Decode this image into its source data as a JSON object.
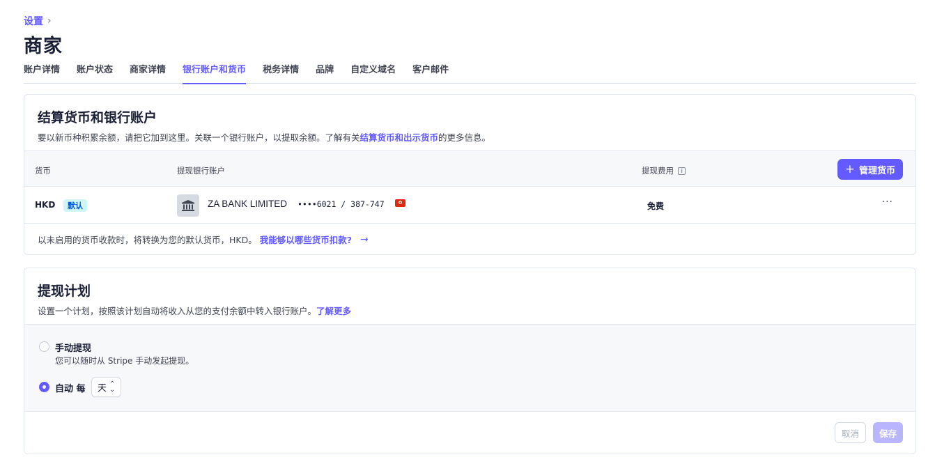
{
  "breadcrumb": {
    "parent": "设置",
    "separator": "›"
  },
  "page": {
    "title": "商家"
  },
  "tabs": [
    {
      "label": "账户详情"
    },
    {
      "label": "账户状态"
    },
    {
      "label": "商家详情"
    },
    {
      "label": "银行账户和货币",
      "active": true
    },
    {
      "label": "税务详情"
    },
    {
      "label": "品牌"
    },
    {
      "label": "自定义域名"
    },
    {
      "label": "客户邮件"
    }
  ],
  "settlement": {
    "title": "结算货币和银行账户",
    "desc_prefix": "要以新币种积累余额，请把它加到这里。关联一个银行账户，以提取余额。了解有关",
    "desc_link": "结算货币和出示货币",
    "desc_suffix": "的更多信息。",
    "columns": {
      "currency": "货币",
      "bank": "提现银行账户",
      "fee": "提现费用",
      "fee_info_icon": "info-icon"
    },
    "manage_button": "管理货币",
    "rows": [
      {
        "currency": "HKD",
        "badge": "默认",
        "bank_name": "ZA BANK LIMITED",
        "account": "••••6021 / 387-747",
        "flag_icon": "hong-kong-flag-icon",
        "fee": "免费",
        "more": "···"
      }
    ],
    "footnote_text": "以未启用的货币收款时，将转换为您的默认货币，HKD。",
    "footnote_link": "我能够以哪些货币扣款?",
    "footnote_arrow": "→"
  },
  "payout": {
    "title": "提现计划",
    "desc_text": "设置一个计划，按照该计划自动将收入从您的支付余额中转入银行账户。",
    "desc_link": "了解更多",
    "manual_label": "手动提现",
    "manual_sub": "您可以随时从 Stripe 手动发起提现。",
    "auto_label": "自动 每",
    "auto_selected": true,
    "interval_value": "天",
    "cancel_label": "取消",
    "save_label": "保存"
  },
  "colors": {
    "accent": "#635bff",
    "badge_bg": "#cff5f6",
    "badge_text": "#045ad0",
    "save_disabled": "#b9b5ff"
  }
}
